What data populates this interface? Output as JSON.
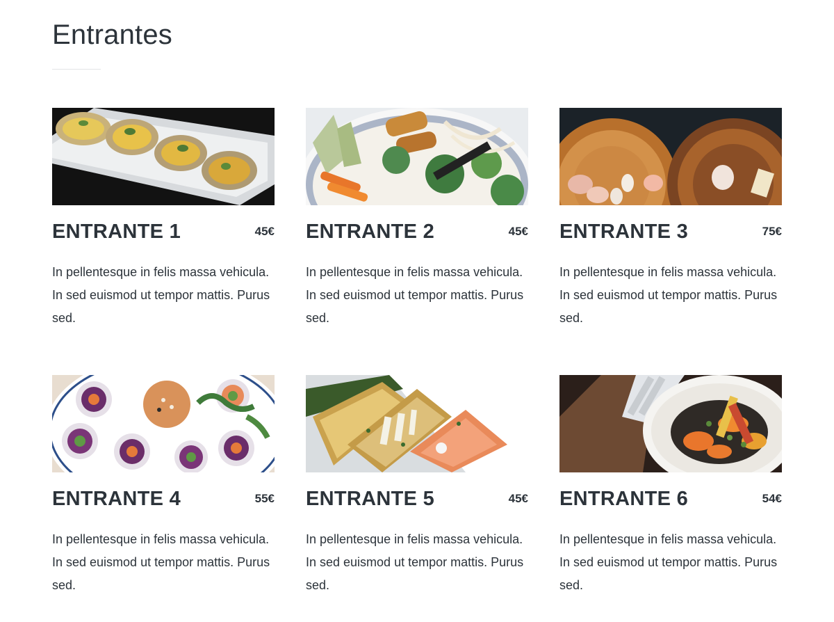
{
  "section": {
    "title": "Entrantes"
  },
  "items": [
    {
      "name": "ENTRANTE 1",
      "price": "45€",
      "description": "In pellentesque in felis massa vehicula. In sed euismod ut tempor mattis. Purus sed.",
      "image": "food-photo-oysters"
    },
    {
      "name": "ENTRANTE 2",
      "price": "45€",
      "description": "In pellentesque in felis massa vehicula. In sed euismod ut tempor mattis. Purus sed.",
      "image": "food-photo-spring-rolls-bowl"
    },
    {
      "name": "ENTRANTE 3",
      "price": "75€",
      "description": "In pellentesque in felis massa vehicula. In sed euismod ut tempor mattis. Purus sed.",
      "image": "food-photo-wooden-boards"
    },
    {
      "name": "ENTRANTE 4",
      "price": "55€",
      "description": "In pellentesque in felis massa vehicula. In sed euismod ut tempor mattis. Purus sed.",
      "image": "food-photo-rice-paper-rolls"
    },
    {
      "name": "ENTRANTE 5",
      "price": "45€",
      "description": "In pellentesque in felis massa vehicula. In sed euismod ut tempor mattis. Purus sed.",
      "image": "food-photo-toast-salmon"
    },
    {
      "name": "ENTRANTE 6",
      "price": "54€",
      "description": "In pellentesque in felis massa vehicula. In sed euismod ut tempor mattis. Purus sed.",
      "image": "food-photo-roasted-vegetables"
    }
  ],
  "colors": {
    "text": "#2c333a",
    "divider": "#e2e4e6",
    "background": "#ffffff"
  }
}
